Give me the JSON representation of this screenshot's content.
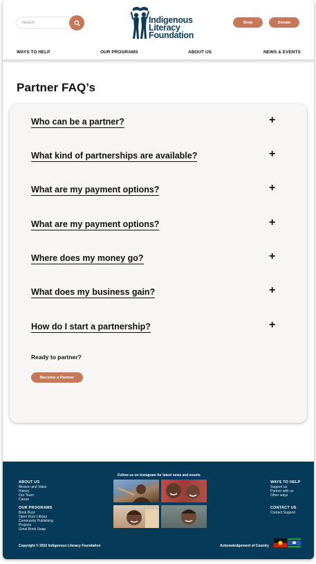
{
  "header": {
    "search_placeholder": "Search",
    "logo": {
      "line1": "Indigenous",
      "line2": "Literacy",
      "line3": "Foundation"
    },
    "shop_label": "Shop",
    "donate_label": "Donate",
    "nav": [
      "WAYS TO HELP",
      "OUR PROGRAMS",
      "ABOUT US",
      "NEWS & EVENTS"
    ]
  },
  "main": {
    "title": "Partner FAQ’s",
    "faqs": [
      "Who can be a partner?",
      "What kind of partnerships are available?",
      "What are my payment options?",
      "What are my payment options?",
      "Where does my money go?",
      "What does my business gain?",
      "How do I start a partnership?"
    ],
    "expand_glyph": "+",
    "ready_text": "Ready to partner?",
    "become_label": "Become a Partner"
  },
  "footer": {
    "about": {
      "heading": "ABOUT US",
      "links": [
        "Mission and Value",
        "History",
        "Our Team",
        "Career"
      ]
    },
    "programs": {
      "heading": "OUR PROGRAMS",
      "links": [
        "Book Buzz",
        "Open Door Library",
        "Community Publishing",
        "Projects",
        "Great Book Swap"
      ]
    },
    "instagram_title": "Follow us on instagram for latest news and events",
    "ways": {
      "heading": "WAYS TO HELP",
      "links": [
        "Support us",
        "Partner with us",
        "Other ways"
      ]
    },
    "contact": {
      "heading": "CONTACT US",
      "links": [
        "Contact Support"
      ]
    },
    "copyright": "Copyright © 2022 Indigenous Literacy Foundation",
    "acknowledgement": "Acknowledgement of Country"
  },
  "colors": {
    "accent": "#c8785a",
    "footer_bg": "#063a59",
    "logo_navy": "#0e3a5a",
    "card_bg": "#f7f6f4"
  },
  "icons": [
    "search-icon",
    "plus-icon",
    "aboriginal-flag-icon",
    "torres-strait-flag-icon"
  ]
}
